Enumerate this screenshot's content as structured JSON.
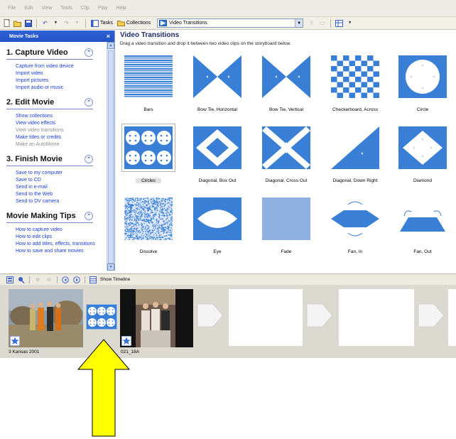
{
  "menu": [
    "File",
    "Edit",
    "View",
    "Tools",
    "Clip",
    "Play",
    "Help"
  ],
  "toolbar": {
    "tasks_label": "Tasks",
    "collections_label": "Collections",
    "collection_selected": "Video Transitions"
  },
  "tasks_pane": {
    "header": "Movie Tasks",
    "close_glyph": "×",
    "sections": [
      {
        "title": "1. Capture Video",
        "items": [
          {
            "label": "Capture from video device",
            "enabled": true
          },
          {
            "label": "Import video",
            "enabled": true
          },
          {
            "label": "Import pictures",
            "enabled": true
          },
          {
            "label": "Import audio or music",
            "enabled": true
          }
        ]
      },
      {
        "title": "2. Edit Movie",
        "items": [
          {
            "label": "Show collections",
            "enabled": true
          },
          {
            "label": "View video effects",
            "enabled": true
          },
          {
            "label": "View video transitions",
            "enabled": false
          },
          {
            "label": "Make titles or credits",
            "enabled": true
          },
          {
            "label": "Make an AutoMovie",
            "enabled": false
          }
        ]
      },
      {
        "title": "3. Finish Movie",
        "items": [
          {
            "label": "Save to my computer",
            "enabled": true
          },
          {
            "label": "Save to CD",
            "enabled": true
          },
          {
            "label": "Send in e-mail",
            "enabled": true
          },
          {
            "label": "Send to the Web",
            "enabled": true
          },
          {
            "label": "Send to DV camera",
            "enabled": true
          }
        ]
      },
      {
        "title": "Movie Making Tips",
        "items": [
          {
            "label": "How to capture video",
            "enabled": true
          },
          {
            "label": "How to edit clips",
            "enabled": true
          },
          {
            "label": "How to add titles, effects, transitions",
            "enabled": true
          },
          {
            "label": "How to save and share movies",
            "enabled": true
          }
        ]
      }
    ]
  },
  "gallery": {
    "title": "Video Transitions",
    "subtitle": "Drag a video transition and drop it between two video clips on the storyboard below.",
    "selected": "Circles",
    "transitions": [
      {
        "name": "Bars",
        "icon": "bars-pattern-icon"
      },
      {
        "name": "Bow Tie, Horizontal",
        "icon": "bow-tie-horizontal-icon"
      },
      {
        "name": "Bow Tie, Vertical",
        "icon": "bow-tie-vertical-icon"
      },
      {
        "name": "Checkerboard, Across",
        "icon": "checkerboard-icon"
      },
      {
        "name": "Circle",
        "icon": "circle-icon"
      },
      {
        "name": "Circles",
        "icon": "circles-icon"
      },
      {
        "name": "Diagonal, Box Out",
        "icon": "diagonal-box-out-icon"
      },
      {
        "name": "Diagonal, Cross Out",
        "icon": "diagonal-cross-out-icon"
      },
      {
        "name": "Diagonal, Down Right",
        "icon": "diagonal-down-right-icon"
      },
      {
        "name": "Diamond",
        "icon": "diamond-icon"
      },
      {
        "name": "Dissolve",
        "icon": "dissolve-icon"
      },
      {
        "name": "Eye",
        "icon": "eye-icon"
      },
      {
        "name": "Fade",
        "icon": "fade-icon"
      },
      {
        "name": "Fan, In",
        "icon": "fan-in-icon"
      },
      {
        "name": "Fan, Out",
        "icon": "fan-out-icon"
      }
    ]
  },
  "storyboard_bar": {
    "show_timeline_label": "Show Timeline"
  },
  "storyboard": {
    "clip1_label": "3 Kansas 2001",
    "clip2_label": "021_18A"
  },
  "colors": {
    "transition_blue": "#3a7fd6",
    "highlight_arrow": "#ffff00",
    "task_link": "#1a3ed4"
  }
}
